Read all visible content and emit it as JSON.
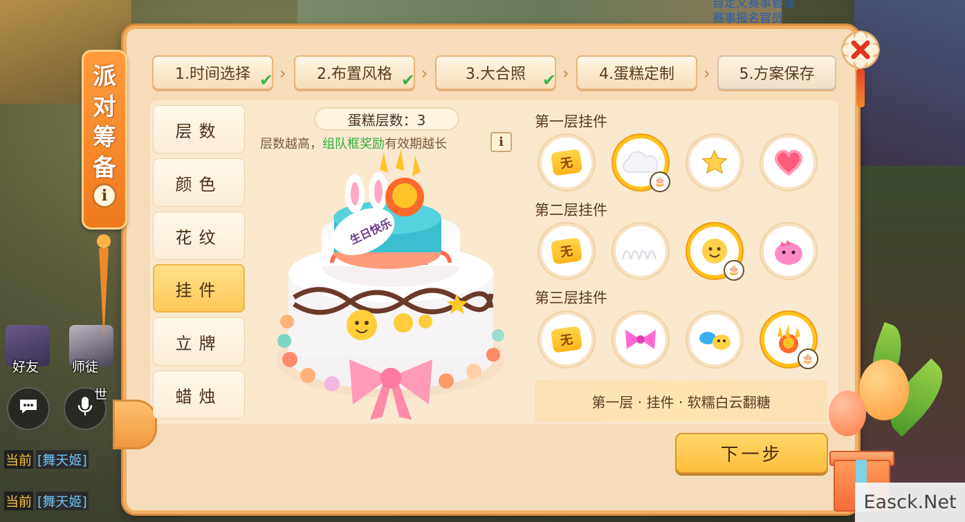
{
  "background": {
    "top_text": "自定义赛事管理\n赛事报名官员"
  },
  "social": {
    "friends_label": "好友",
    "mentor_label": "师徒",
    "extra_char": "世",
    "chat_icon": "chat-bubble-icon",
    "voice_icon": "microphone-icon"
  },
  "chat": [
    {
      "channel": "当前",
      "name": "[舞天姬]"
    },
    {
      "channel": "当前",
      "name": "[舞天姬]"
    }
  ],
  "dialog": {
    "banner_title": [
      "派",
      "对",
      "筹",
      "备"
    ],
    "banner_info": "i",
    "close_icon": "close-x-icon"
  },
  "steps": [
    {
      "label": "1.时间选择",
      "done": true
    },
    {
      "label": "2.布置风格",
      "done": true
    },
    {
      "label": "3.大合照",
      "done": true
    },
    {
      "label": "4.蛋糕定制",
      "done": false
    },
    {
      "label": "5.方案保存",
      "done": false,
      "current": true
    }
  ],
  "step_check_symbol": "✔",
  "step_arrow_symbol": "›",
  "tabs": [
    {
      "label": "层数"
    },
    {
      "label": "颜色"
    },
    {
      "label": "花纹"
    },
    {
      "label": "挂件",
      "selected": true
    },
    {
      "label": "立牌"
    },
    {
      "label": "蜡烛"
    }
  ],
  "cake": {
    "layer_count_label": "蛋糕层数：3",
    "hint_prefix": "层数越高，",
    "hint_highlight": "组队框奖励",
    "hint_suffix": "有效期越长",
    "hint_info": "i",
    "plaque_text": "生日快乐"
  },
  "decorations": {
    "rows": [
      {
        "title": "第一层挂件",
        "items": [
          "none",
          "cloud",
          "star",
          "heart"
        ],
        "selected_index": 1
      },
      {
        "title": "第二层挂件",
        "items": [
          "none",
          "cream-drops",
          "smiley",
          "pink-blob"
        ],
        "selected_index": 2
      },
      {
        "title": "第三层挂件",
        "items": [
          "none",
          "pink-bow",
          "sea-animals",
          "golden-crest"
        ],
        "selected_index": 3
      }
    ],
    "none_label": "无"
  },
  "selected_item_name": "第一层 · 挂件 · 软糯白云翻糖",
  "next_button": "下一步",
  "watermark": "Easck.Net",
  "colors": {
    "accent_orange": "#f0b165",
    "selected_gold": "#ffc21a",
    "check_green": "#37b54a",
    "highlight_green": "#2fae3a"
  }
}
